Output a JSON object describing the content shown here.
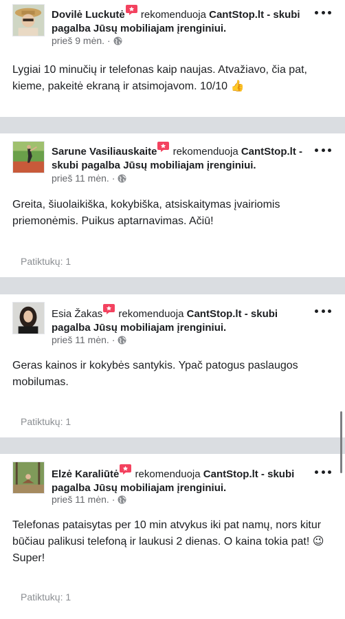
{
  "accent_colors": {
    "badge": "#f3425f",
    "muted": "#65676b",
    "likes": "#8a8d91"
  },
  "posts": [
    {
      "author": "Dovilė Luckutė",
      "verb": "rekomenduoja",
      "page": "CantStop.lt - skubi pagalba Jūsų mobiliajam įrenginiui.",
      "time": "prieš 9 mėn.",
      "text": "Lygiai 10 minučių ir telefonas kaip naujas. Atvažiavo, čia pat, kieme, pakeitė ekraną ir atsimojavom. 10/10 👍",
      "likes": ""
    },
    {
      "author": "Sarune Vasiliauskaite",
      "verb": "rekomenduoja",
      "page": "CantStop.lt - skubi pagalba Jūsų mobiliajam įrenginiui.",
      "time": "prieš 11 mėn.",
      "text": "Greita, šiuolaikiška, kokybiška, atsiskaitymas įvairiomis priemonėmis. Puikus aptarnavimas. Ačiū!",
      "likes": "Patiktukų: 1"
    },
    {
      "author": "Esia Žakas",
      "verb": "rekomenduoja",
      "page": "CantStop.lt - skubi pagalba Jūsų mobiliajam įrenginiui.",
      "time": "prieš 11 mėn.",
      "text": "Geras kainos ir kokybės santykis. Ypač patogus paslaugos mobilumas.",
      "likes": "Patiktukų: 1"
    },
    {
      "author": "Elzė Karaliūtė",
      "verb": "rekomenduoja",
      "page": "CantStop.lt - skubi pagalba Jūsų mobiliajam įrenginiui.",
      "time": "prieš 11 mėn.",
      "text": "Telefonas pataisytas per 10 min atvykus iki pat namų, nors kitur būčiau palikusi telefoną ir laukusi 2 dienas. O kaina tokia pat! 😉 Super!",
      "likes": "Patiktukų: 1"
    }
  ]
}
